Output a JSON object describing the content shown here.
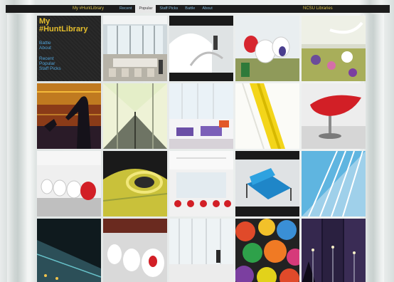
{
  "topbar": {
    "brand": "My #HuntLibrary",
    "nav": [
      "Recent",
      "Popular",
      "Staff Picks",
      "Battle",
      "About"
    ],
    "active_nav": "Popular",
    "org": "NCSU Libraries"
  },
  "sidebar": {
    "title_line1": "My",
    "title_line2": "#HuntLibrary",
    "links_group1": [
      "Battle",
      "About"
    ],
    "links_group2": [
      "Recent",
      "Popular",
      "Staff Picks"
    ]
  },
  "colors": {
    "topbar_bg": "#1c1c1c",
    "title_yellow": "#e6bf2c",
    "link_blue": "#4fa3d9"
  },
  "photos": [
    "photo-conference-room",
    "photo-white-curved-wall",
    "photo-red-white-egg-chairs",
    "photo-overhead-lounge",
    "photo-silhouette-cyberpunk",
    "photo-reflecting-walkway",
    "photo-purple-furniture-area",
    "photo-yellow-stairs",
    "photo-red-chair",
    "photo-white-pod-chairs",
    "photo-yellow-ring-structure",
    "photo-red-chairs-atrium",
    "photo-blue-tufted-chair",
    "photo-blue-facade-fins",
    "photo-building-night",
    "photo-pod-chairs-lobby",
    "photo-person-in-hall",
    "photo-colorful-balls",
    "photo-night-street-lights"
  ]
}
